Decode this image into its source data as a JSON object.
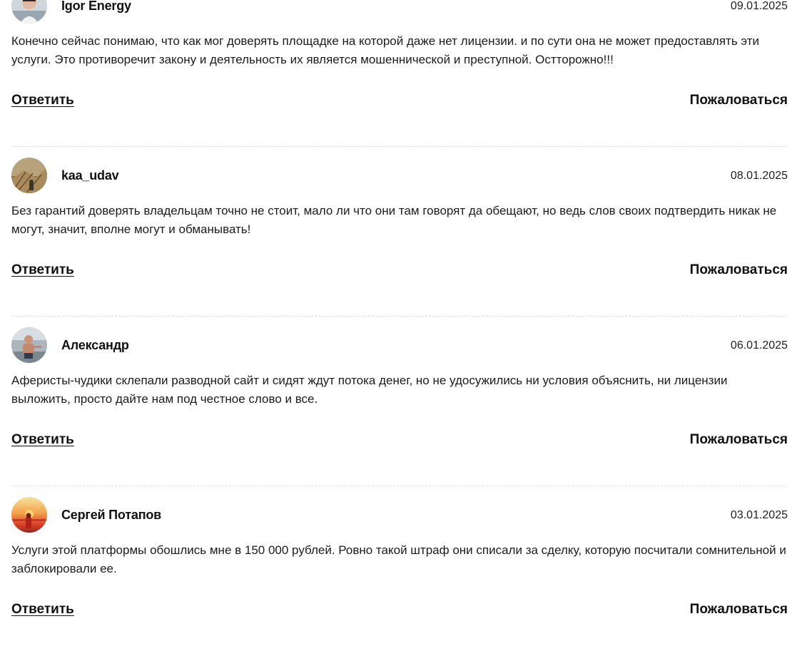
{
  "comments": [
    {
      "author": "Igor Energy",
      "date": "09.01.2025",
      "text": "Конечно сейчас понимаю, что как мог доверять площадке на которой даже нет лицензии. и по сути она не может предоставлять эти услуги. Это противоречит закону и деятельность их является мошеннической и преступной. Остторожно!!!",
      "reply_label": "Ответить",
      "report_label": "Пожаловаться",
      "avatar_icon": "user-photo-icon"
    },
    {
      "author": "kaa_udav",
      "date": "08.01.2025",
      "text": "Без гарантий доверять владельцам точно не стоит, мало ли что они там говорят да обещают, но ведь слов своих подтвердить никак не могут, значит, вполне могут и обманывать!",
      "reply_label": "Ответить",
      "report_label": "Пожаловаться",
      "avatar_icon": "user-photo-icon"
    },
    {
      "author": "Александр",
      "date": "06.01.2025",
      "text": "Аферисты-чудики склепали разводной сайт и сидят ждут потока денег, но не удосужились ни условия объяснить, ни лицензии выложить, просто дайте нам под честное слово и все.",
      "reply_label": "Ответить",
      "report_label": "Пожаловаться",
      "avatar_icon": "user-photo-icon"
    },
    {
      "author": "Сергей Потапов",
      "date": "03.01.2025",
      "text": "Услуги этой платформы обошлись мне в 150 000 рублей. Ровно такой штраф они списали за сделку, которую посчитали сомнительной и заблокировали ее.",
      "reply_label": "Ответить",
      "report_label": "Пожаловаться",
      "avatar_icon": "user-photo-icon"
    }
  ]
}
